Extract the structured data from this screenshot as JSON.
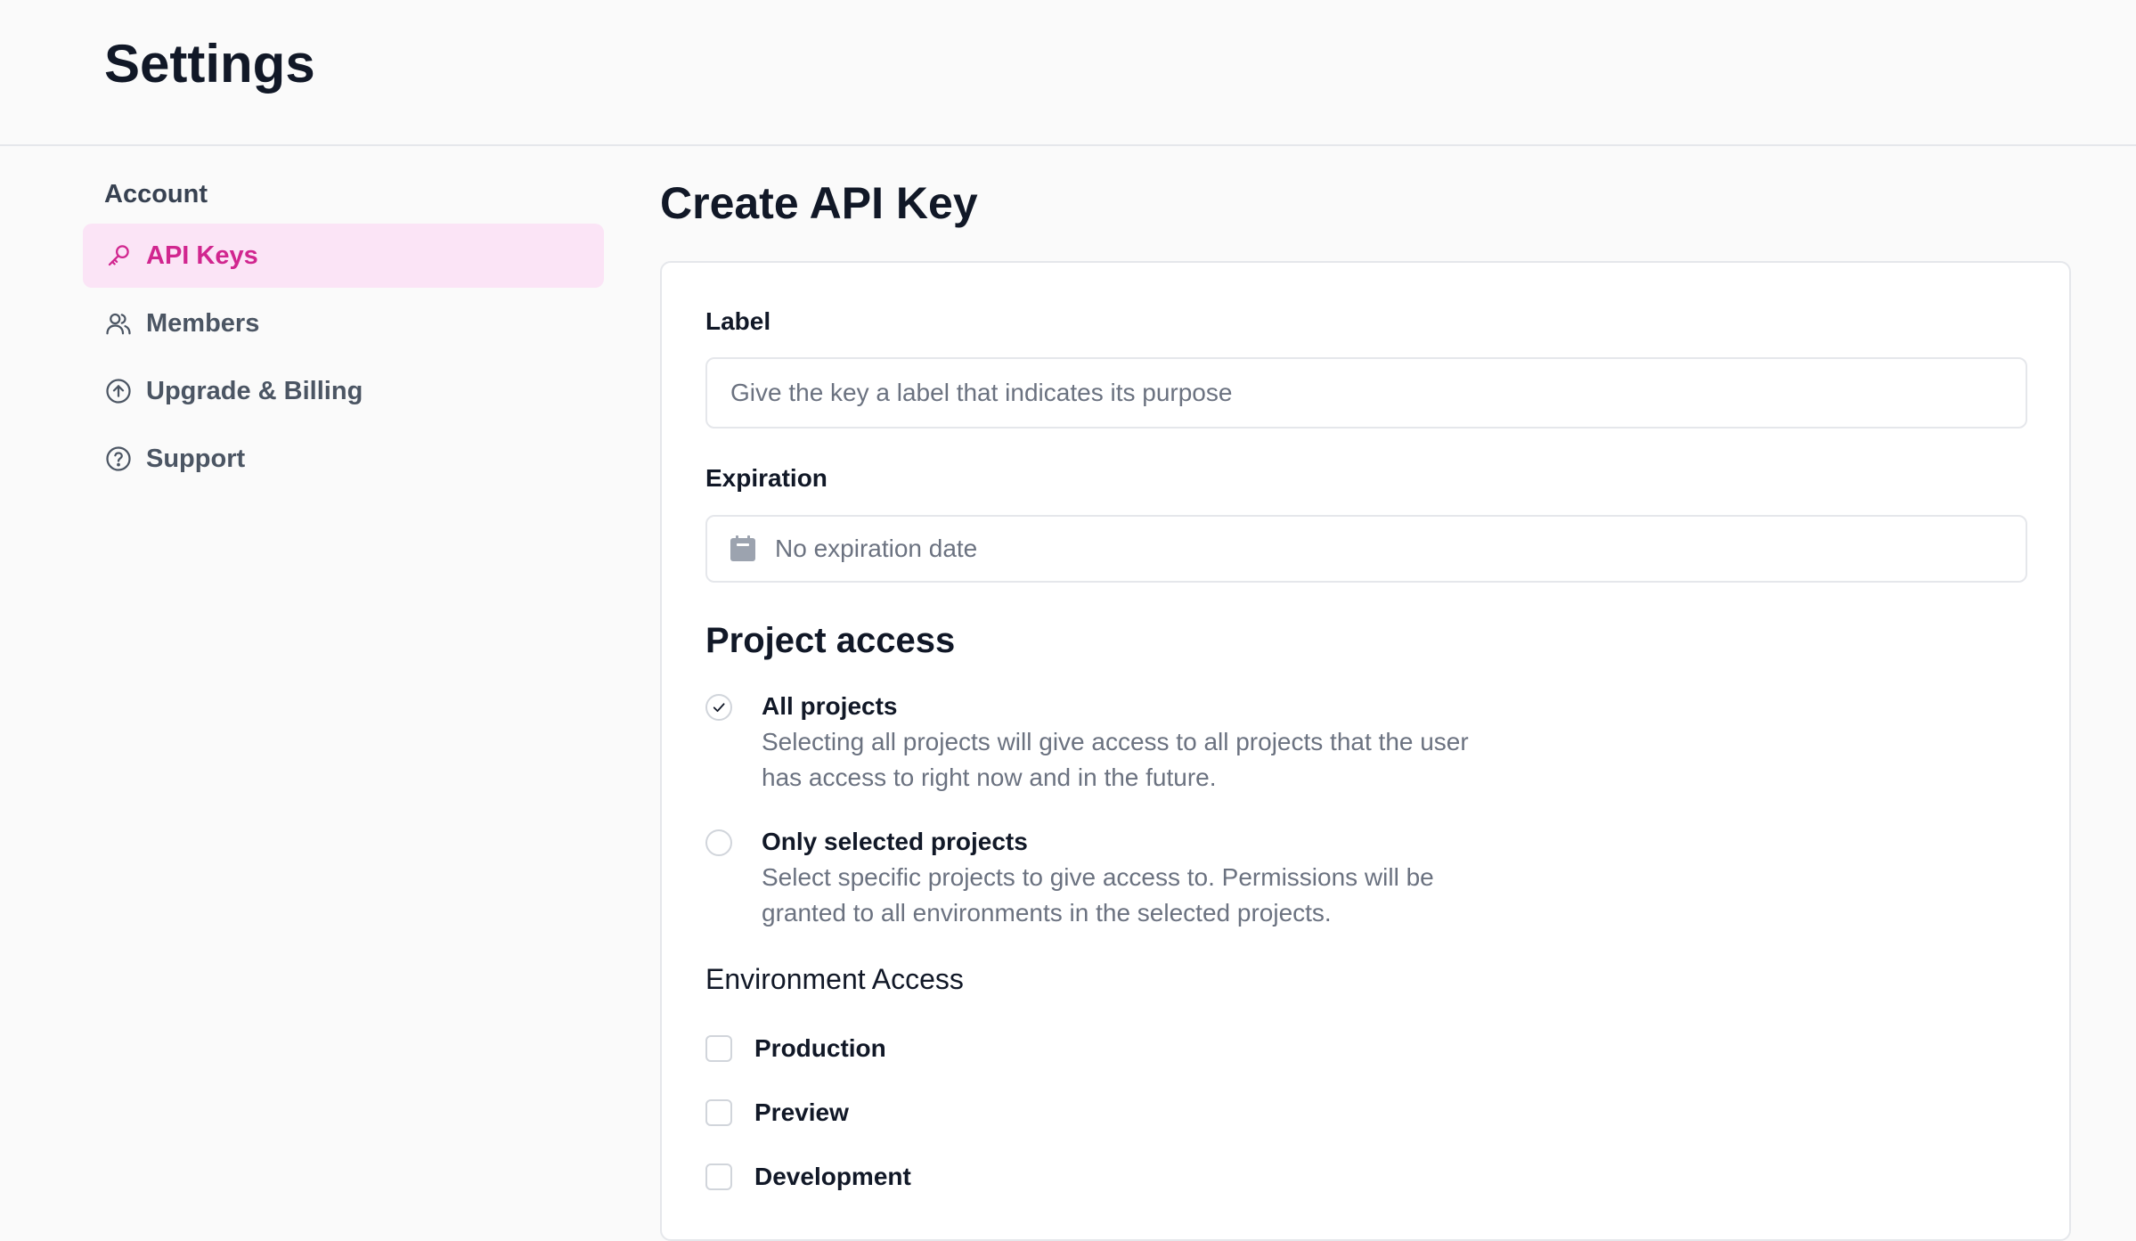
{
  "header": {
    "title": "Settings"
  },
  "sidebar": {
    "section_title": "Account",
    "items": [
      {
        "label": "API Keys",
        "icon": "key-icon",
        "active": true
      },
      {
        "label": "Members",
        "icon": "users-icon",
        "active": false
      },
      {
        "label": "Upgrade & Billing",
        "icon": "arrow-up-circle-icon",
        "active": false
      },
      {
        "label": "Support",
        "icon": "help-circle-icon",
        "active": false
      }
    ]
  },
  "main": {
    "title": "Create API Key",
    "label_field": {
      "label": "Label",
      "value": "",
      "placeholder": "Give the key a label that indicates its purpose"
    },
    "expiration_field": {
      "label": "Expiration",
      "value": "No expiration date",
      "icon": "calendar-icon"
    },
    "project_access": {
      "heading": "Project access",
      "options": [
        {
          "title": "All projects",
          "description": "Selecting all projects will give access to all projects that the user has access to right now and in the future.",
          "selected": true
        },
        {
          "title": "Only selected projects",
          "description": "Select specific projects to give access to. Permissions will be granted to all environments in the selected projects.",
          "selected": false
        }
      ]
    },
    "environment_access": {
      "heading": "Environment Access",
      "options": [
        {
          "label": "Production",
          "checked": false
        },
        {
          "label": "Preview",
          "checked": false
        },
        {
          "label": "Development",
          "checked": false
        }
      ]
    }
  },
  "colors": {
    "accent": "#d1268f",
    "accent_bg": "#fbe4f6",
    "background": "#fafafa",
    "text": "#111827",
    "muted": "#6b7280"
  }
}
